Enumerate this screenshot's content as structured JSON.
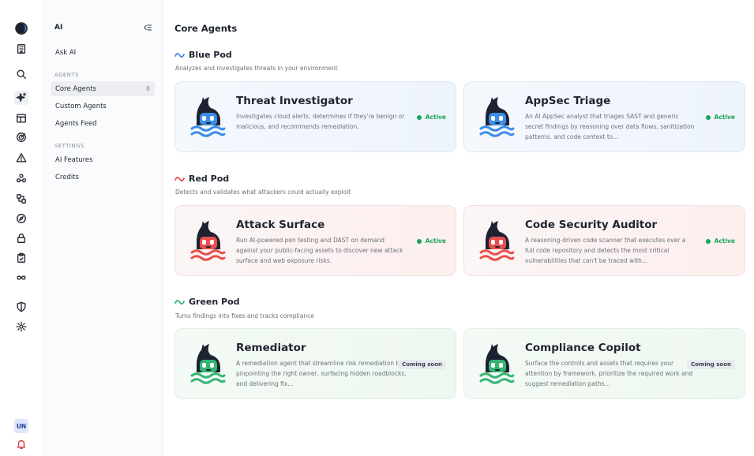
{
  "rail": {
    "icons": [
      "logo-icon",
      "building-icon",
      "search-icon",
      "sparkle-icon",
      "layout-icon",
      "target-icon",
      "warning-icon",
      "cluster-icon",
      "workflow-icon",
      "compass-icon",
      "lock-icon",
      "clipboard-icon",
      "infinity-icon",
      "shield-icon",
      "gear-icon",
      "bell-icon"
    ],
    "avatar_initials": "UN"
  },
  "sidebar": {
    "title": "AI",
    "ask_ai": "Ask AI",
    "agents_section": "AGENTS",
    "agents_items": [
      {
        "label": "Core Agents",
        "count": "8",
        "active": true
      },
      {
        "label": "Custom Agents",
        "count": "",
        "active": false
      },
      {
        "label": "Agents Feed",
        "count": "",
        "active": false
      }
    ],
    "settings_section": "SETTINGS",
    "settings_items": [
      {
        "label": "AI Features"
      },
      {
        "label": "Credits"
      }
    ]
  },
  "main": {
    "title": "Core Agents",
    "pods": [
      {
        "name": "Blue Pod",
        "color": "#3b8ee6",
        "description": "Analyzes and investigates threats in your environment",
        "cards": [
          {
            "title": "Threat Investigator",
            "description": "Investigates cloud alerts, determines if they're benign or malicious, and recommends remediation.",
            "status": "Active"
          },
          {
            "title": "AppSec Triage",
            "description": "An AI AppSec analyst that triages SAST and generic secret findings by reasoning over data flows, sanitization patterns, and code context to...",
            "status": "Active"
          }
        ]
      },
      {
        "name": "Red Pod",
        "color": "#e8504d",
        "description": "Detects and validates what attackers could actually exploit",
        "cards": [
          {
            "title": "Attack Surface",
            "description": "Run AI-powered pen testing and DAST on demand against your public-facing assets to discover new attack surface and web exposure risks.",
            "status": "Active"
          },
          {
            "title": "Code Security Auditor",
            "description": "A reasoning-driven code scanner that executes over a full code repository and detects the most critical vulnerabilities that can't be traced with...",
            "status": "Active"
          }
        ]
      },
      {
        "name": "Green Pod",
        "color": "#36b574",
        "description": "Turns findings into fixes and tracks compliance",
        "cards": [
          {
            "title": "Remediator",
            "description": "A remediation agent that streamline risk remediation by pinpointing the right owner, surfacing hidden roadblocks, and delivering fix...",
            "status": "Coming soon"
          },
          {
            "title": "Compliance Copilot",
            "description": "Surface the controls and assets that requires your attention by framework, prioritize the required work and suggest remediation paths...",
            "status": "Coming soon"
          }
        ]
      }
    ]
  }
}
